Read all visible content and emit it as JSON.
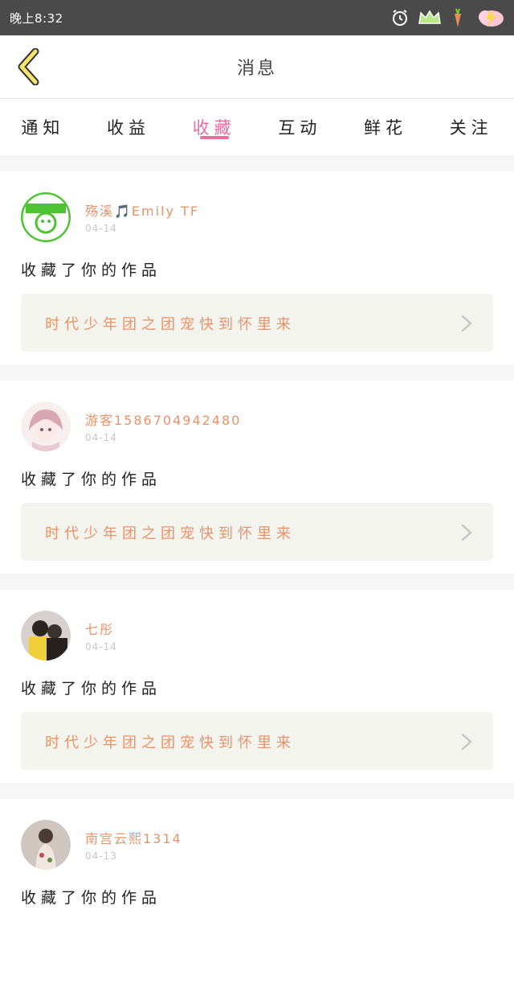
{
  "status_bar": {
    "time": "晚上8:32",
    "icons": [
      "alarm-icon",
      "crown-icon",
      "carrot-icon",
      "weather-icon"
    ]
  },
  "header": {
    "back_icon": "chevron-left-icon",
    "title": "消息"
  },
  "tabs": [
    {
      "label": "通知",
      "active": false
    },
    {
      "label": "收益",
      "active": false
    },
    {
      "label": "收藏",
      "active": true
    },
    {
      "label": "互动",
      "active": false
    },
    {
      "label": "鲜花",
      "active": false
    },
    {
      "label": "关注",
      "active": false
    }
  ],
  "colors": {
    "accent_pink": "#e76fa0",
    "name_orange": "#e8936a",
    "card_bg": "#f4f4ef"
  },
  "messages": [
    {
      "user": "殇溪🎵Emily TF",
      "time": "04-14",
      "action": "收藏了你的作品",
      "work_title": "时代少年团之团宠快到怀里来"
    },
    {
      "user": "游客1586704942480",
      "time": "04-14",
      "action": "收藏了你的作品",
      "work_title": "时代少年团之团宠快到怀里来"
    },
    {
      "user": "七彤",
      "time": "04-14",
      "action": "收藏了你的作品",
      "work_title": "时代少年团之团宠快到怀里来"
    },
    {
      "user": "南宫云熙1314",
      "time": "04-13",
      "action": "收藏了你的作品",
      "work_title": ""
    }
  ]
}
